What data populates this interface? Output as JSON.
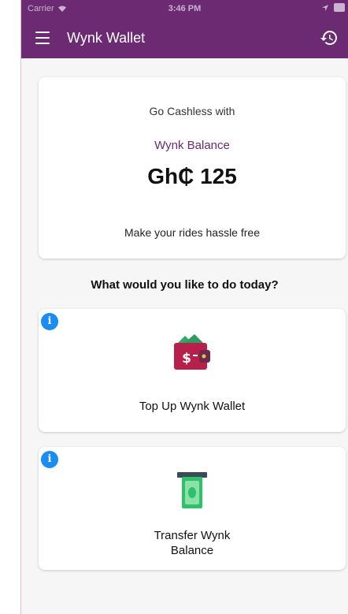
{
  "status_bar": {
    "carrier": "Carrier",
    "time": "3:46 PM"
  },
  "app_bar": {
    "title": "Wynk Wallet",
    "menu_icon": "hamburger-menu-icon",
    "history_icon": "history-icon"
  },
  "balance_card": {
    "line1": "Go Cashless with",
    "line2": "Wynk Balance",
    "amount": "Gh₵ 125",
    "line3": "Make your rides hassle free"
  },
  "question": "What would you like to do today?",
  "actions": [
    {
      "label": "Top Up Wynk Wallet",
      "icon": "wallet-icon"
    },
    {
      "label_line1": "Transfer Wynk",
      "label_line2": "Balance",
      "icon": "atm-cash-icon"
    }
  ],
  "colors": {
    "brand": "#6b2a72",
    "info": "#1a8cf2"
  }
}
